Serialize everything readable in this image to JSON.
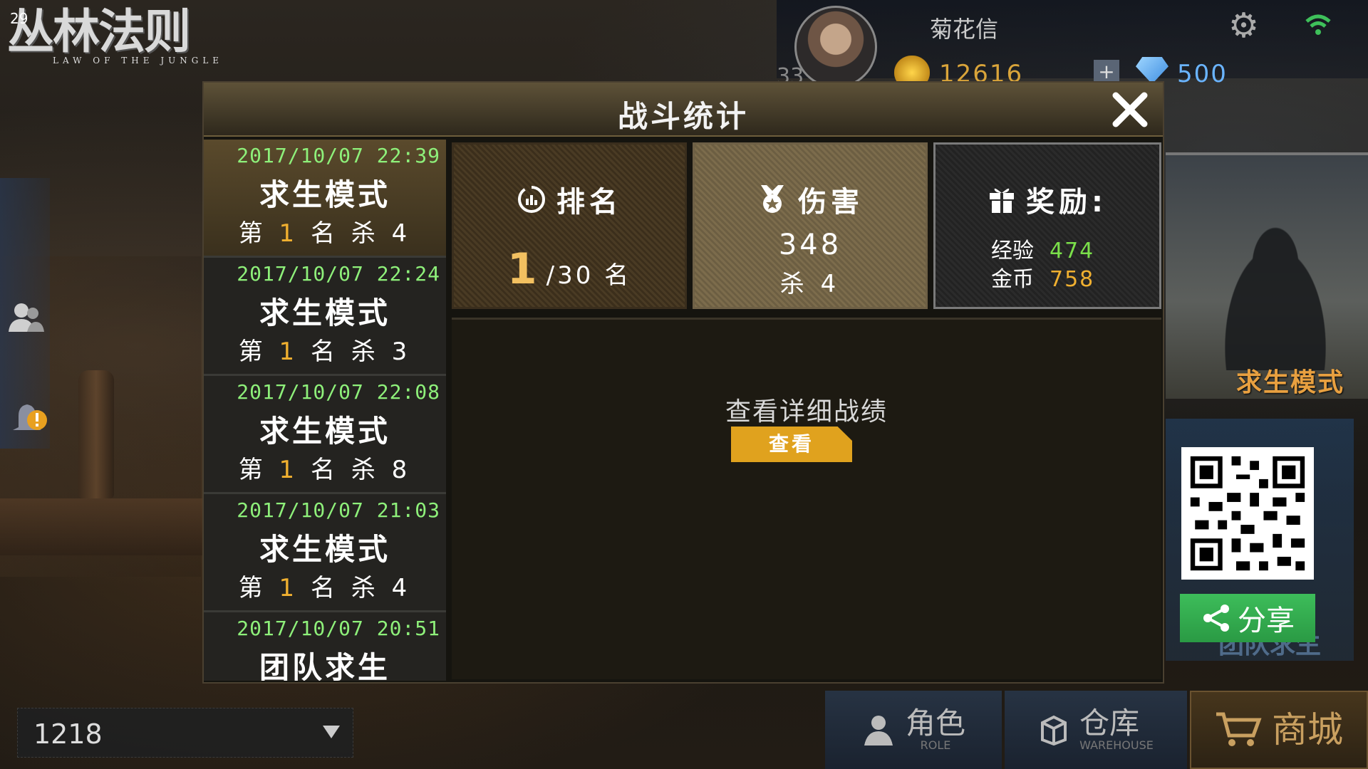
{
  "hud": {
    "fps": "29",
    "logo_title": "丛林法则",
    "logo_subtitle": "LAW OF  THE JUNGLE"
  },
  "player": {
    "name": "菊花信",
    "level": "33",
    "gold": "12616",
    "diamonds": "500",
    "plus_label": "+"
  },
  "dialog": {
    "title": "战斗统计",
    "history": [
      {
        "date": "2017/10/07 22:39",
        "mode": "求生模式",
        "rank_prefix": "第",
        "rank": "1",
        "rank_suffix": "名",
        "kills_label": "杀",
        "kills": "4"
      },
      {
        "date": "2017/10/07 22:24",
        "mode": "求生模式",
        "rank_prefix": "第",
        "rank": "1",
        "rank_suffix": "名",
        "kills_label": "杀",
        "kills": "3"
      },
      {
        "date": "2017/10/07 22:08",
        "mode": "求生模式",
        "rank_prefix": "第",
        "rank": "1",
        "rank_suffix": "名",
        "kills_label": "杀",
        "kills": "8"
      },
      {
        "date": "2017/10/07 21:03",
        "mode": "求生模式",
        "rank_prefix": "第",
        "rank": "1",
        "rank_suffix": "名",
        "kills_label": "杀",
        "kills": "4"
      },
      {
        "date": "2017/10/07 20:51",
        "mode": "团队求生"
      }
    ],
    "rank_panel": {
      "title": "排名",
      "value": "1",
      "total": "/30 名"
    },
    "damage_panel": {
      "title": "伤害",
      "value": "348",
      "kills": "杀 4"
    },
    "reward_panel": {
      "title": "奖励:",
      "xp_label": "经验",
      "xp_value": "474",
      "coin_label": "金币",
      "coin_value": "758"
    },
    "detail_label": "查看详细战绩",
    "view_button": "查看"
  },
  "side": {
    "mode_label": "求生模式",
    "team_label": "团队求生",
    "share_label": "分享"
  },
  "bottom": {
    "server_value": "1218",
    "nav": [
      {
        "label": "角色",
        "sub": "ROLE"
      },
      {
        "label": "仓库",
        "sub": "WAREHOUSE"
      },
      {
        "label": "商城"
      }
    ]
  },
  "colors": {
    "accent_gold": "#f0b030",
    "date_green": "#8ef07a",
    "xp_green": "#7be04a",
    "button_yellow": "#e0a21e",
    "share_green": "#3dbd5a"
  },
  "icons": [
    "gear-icon",
    "wifi-icon",
    "gold-icon",
    "diamond-icon",
    "friends-icon",
    "alert-icon",
    "rank-icon",
    "medal-icon",
    "gift-icon",
    "close-icon",
    "share-icon",
    "role-icon",
    "warehouse-icon",
    "cart-icon",
    "caret-down-icon"
  ]
}
